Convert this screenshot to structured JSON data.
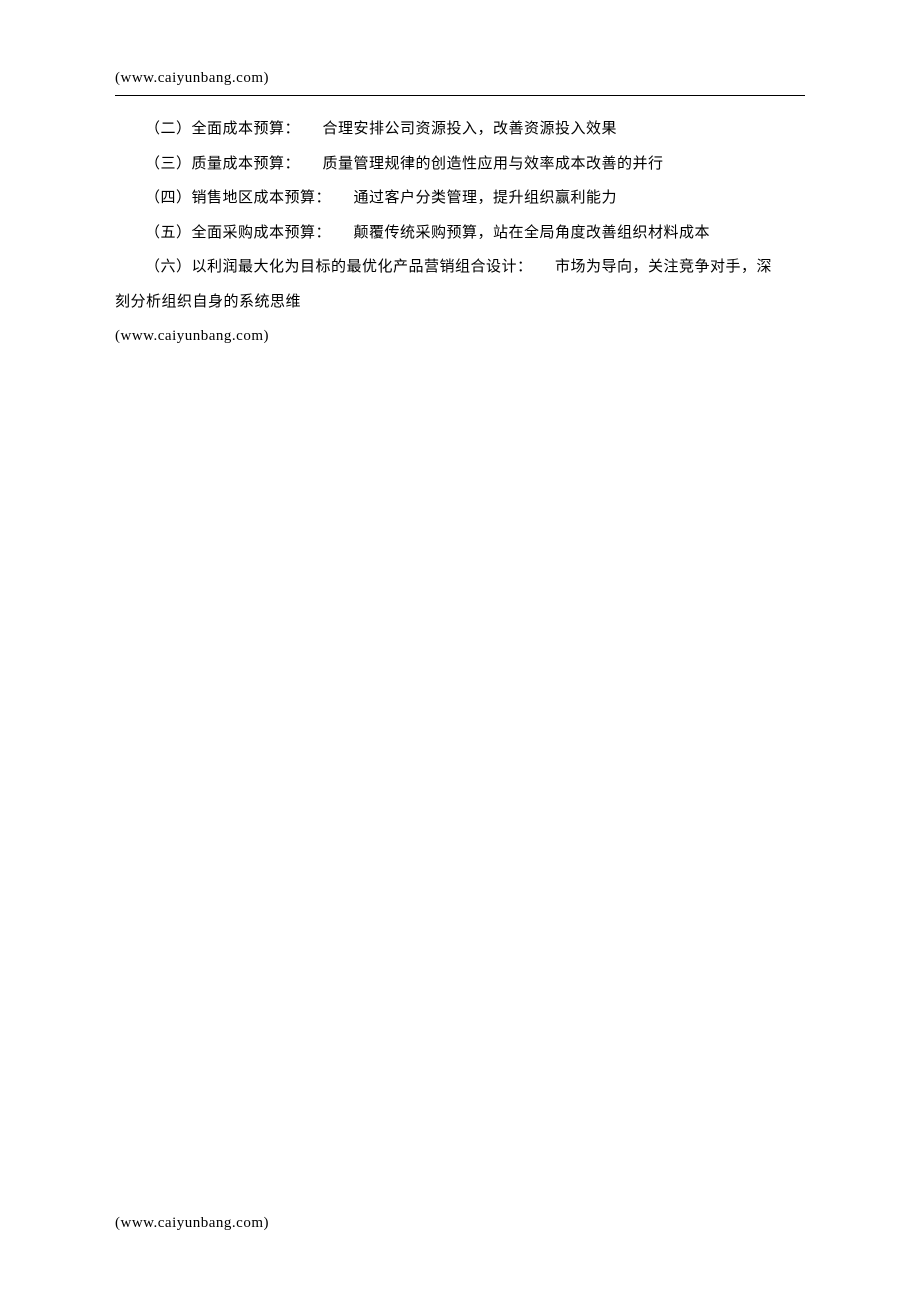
{
  "header": {
    "url": "(www.caiyunbang.com)"
  },
  "items": [
    {
      "label": "（二）全面成本预算：",
      "desc": "合理安排公司资源投入，改善资源投入效果"
    },
    {
      "label": "（三）质量成本预算：",
      "desc": "质量管理规律的创造性应用与效率成本改善的并行"
    },
    {
      "label": "（四）销售地区成本预算：",
      "desc": "通过客户分类管理，提升组织赢利能力"
    },
    {
      "label": "（五）全面采购成本预算：",
      "desc": "颠覆传统采购预算，站在全局角度改善组织材料成本"
    },
    {
      "label": "（六）以利润最大化为目标的最优化产品营销组合设计：",
      "desc": "市场为导向，关注竞争对手，深"
    }
  ],
  "continuation": "刻分析组织自身的系统思维",
  "mid_url": "(www.caiyunbang.com)",
  "footer": {
    "url": "(www.caiyunbang.com)"
  }
}
